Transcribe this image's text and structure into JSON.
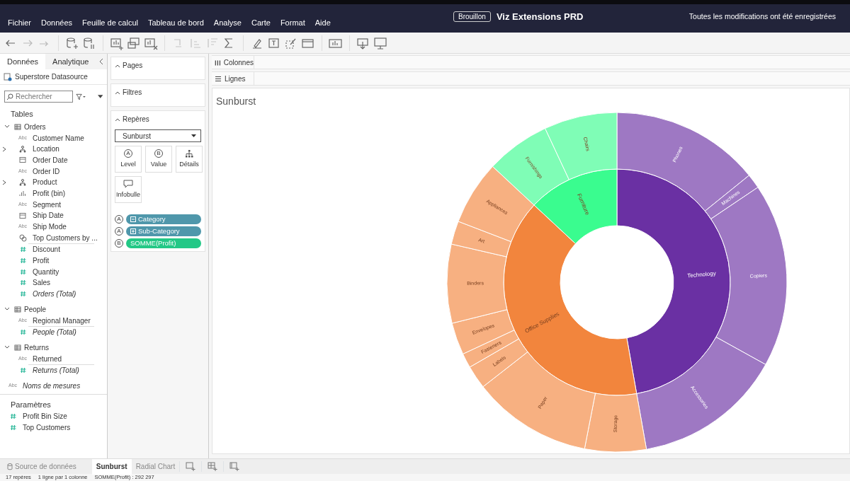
{
  "header": {
    "menu": [
      "Fichier",
      "Données",
      "Feuille de calcul",
      "Tableau de bord",
      "Analyse",
      "Carte",
      "Format",
      "Aide"
    ],
    "status_badge": "Brouillon",
    "title": "Viz Extensions PRD",
    "save_status": "Toutes les modifications ont été enregistrées"
  },
  "data_pane": {
    "tabs": [
      {
        "label": "Données",
        "selected": true
      },
      {
        "label": "Analytique",
        "selected": false
      }
    ],
    "datasource": "Superstore Datasource",
    "search": {
      "placeholder": "Rechercher"
    },
    "tables_heading": "Tables",
    "tables": [
      {
        "name": "Orders",
        "expanded": true,
        "fields": [
          {
            "kind": "dimension",
            "type_label": "Abc",
            "name": "Customer Name"
          },
          {
            "kind": "hierarchy",
            "name": "Location"
          },
          {
            "kind": "date",
            "name": "Order Date"
          },
          {
            "kind": "dimension",
            "type_label": "Abc",
            "name": "Order ID"
          },
          {
            "kind": "hierarchy",
            "name": "Product"
          },
          {
            "kind": "bin",
            "name": "Profit (bin)"
          },
          {
            "kind": "dimension",
            "type_label": "Abc",
            "name": "Segment"
          },
          {
            "kind": "date",
            "name": "Ship Date"
          },
          {
            "kind": "dimension",
            "type_label": "Abc",
            "name": "Ship Mode"
          },
          {
            "kind": "set",
            "name": "Top Customers by ..."
          },
          {
            "kind": "measure",
            "name": "Discount"
          },
          {
            "kind": "measure",
            "name": "Profit"
          },
          {
            "kind": "measure",
            "name": "Quantity"
          },
          {
            "kind": "measure",
            "name": "Sales"
          },
          {
            "kind": "total",
            "name": "Orders (Total)"
          }
        ]
      },
      {
        "name": "People",
        "expanded": true,
        "fields": [
          {
            "kind": "dimension",
            "type_label": "Abc",
            "name": "Regional Manager"
          },
          {
            "kind": "total",
            "name": "People (Total)"
          }
        ]
      },
      {
        "name": "Returns",
        "expanded": true,
        "fields": [
          {
            "kind": "dimension",
            "type_label": "Abc",
            "name": "Returned"
          },
          {
            "kind": "total",
            "name": "Returns (Total)"
          }
        ]
      }
    ],
    "measure_names": {
      "type_label": "Abc",
      "name": "Noms de mesures"
    },
    "parameters_heading": "Paramètres",
    "parameters": [
      "Profit Bin Size",
      "Top Customers"
    ]
  },
  "cards": {
    "pages": "Pages",
    "filters": "Filtres",
    "marks": "Repères",
    "mark_type": "Sunburst",
    "mark_buttons": [
      {
        "kind": "letter",
        "letter": "A",
        "label": "Level"
      },
      {
        "kind": "letter",
        "letter": "B",
        "label": "Value"
      },
      {
        "kind": "detail",
        "label": "Détails"
      },
      {
        "kind": "tooltip",
        "label": "Infobulle"
      }
    ],
    "pills": [
      {
        "letter": "A",
        "kind": "collapse",
        "label": "Category",
        "color": "#4f97ab"
      },
      {
        "letter": "A",
        "kind": "expand",
        "label": "Sub-Category",
        "color": "#4f97ab"
      },
      {
        "letter": "B",
        "kind": "measure",
        "label": "SOMME(Profit)",
        "color": "#23c886"
      }
    ]
  },
  "shelves": [
    {
      "kind": "columns",
      "label": "Colonnes"
    },
    {
      "kind": "rows",
      "label": "Lignes"
    }
  ],
  "sheet": {
    "title": "Sunburst",
    "categories": [
      {
        "label": "Technology",
        "color": "#6a30a3",
        "children": [
          "Phones",
          "Machines",
          "Copiers",
          "Accessories"
        ]
      },
      {
        "label": "Office Supplies",
        "color": "#f2853d",
        "children": [
          "Storage",
          "Paper",
          "Labels",
          "Fasteners",
          "Envelopes",
          "Binders",
          "Art",
          "Appliances"
        ]
      },
      {
        "label": "Furniture",
        "color": "#3afc8f",
        "children": [
          "Furnishings",
          "Chairs"
        ]
      }
    ]
  },
  "sheet_tabs": [
    {
      "label": "Source de données",
      "kind": "datasource",
      "selected": false
    },
    {
      "label": "Sunburst",
      "kind": "sheet",
      "selected": true
    },
    {
      "label": "Radial Chart",
      "kind": "sheet",
      "selected": false
    }
  ],
  "status_bar": [
    "17 repères",
    "1 ligne par 1 colonne",
    "SOMME(Profit) : 292 297"
  ]
}
